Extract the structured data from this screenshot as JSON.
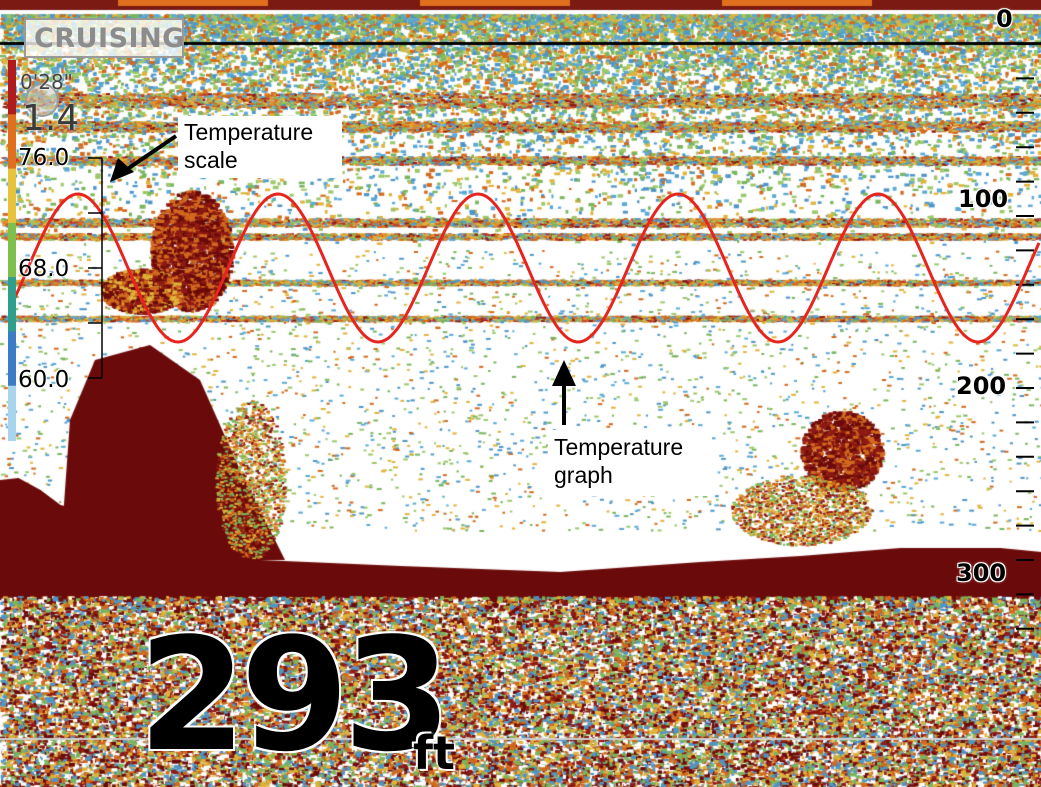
{
  "screen": {
    "mode_label": "CRUISING",
    "speed_small": "0'28\"",
    "speed_large": "1.4",
    "depth": {
      "value": "293",
      "unit": "ft"
    }
  },
  "depth_scale": {
    "labels": [
      "0",
      "100",
      "200",
      "300"
    ],
    "values": [
      0,
      100,
      200,
      300
    ],
    "max_depth": 340
  },
  "temperature_scale": {
    "labels": [
      "76.0",
      "68.0",
      "60.0"
    ],
    "values": [
      76,
      68,
      60
    ]
  },
  "annotations": {
    "scale_callout": {
      "line1": "Temperature",
      "line2": "scale"
    },
    "graph_callout": {
      "line1": "Temperature",
      "line2": "graph"
    }
  },
  "colors": {
    "bottom": "#6b0a0a",
    "echo_strong": "#8e1a14",
    "echo_mid": "#d2691e",
    "echo_weak": "#e0b33a",
    "clutter_green": "#7ab55c",
    "clutter_blue": "#4e95c6",
    "temp_line": "#e8241e",
    "gain_bar": [
      "#b01c1c",
      "#e0701e",
      "#e8c23a",
      "#7fbf4e",
      "#2f9e8c",
      "#3b7cc4",
      "#a9d4ee"
    ]
  },
  "icons": {
    "mode_icon": "sonar-mode-icon",
    "pointer_arrow": "arrow-icon"
  }
}
